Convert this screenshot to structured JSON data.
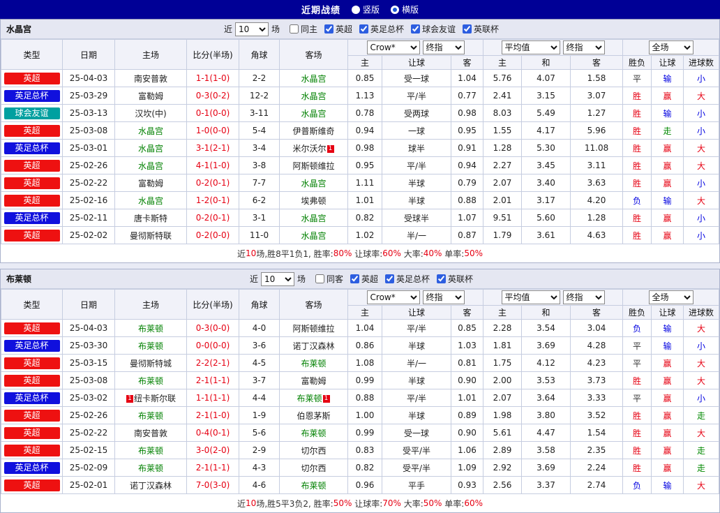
{
  "topbar": {
    "title": "近期战绩",
    "options": [
      {
        "label": "竖版",
        "selected": false
      },
      {
        "label": "横版",
        "selected": true
      }
    ]
  },
  "colors": {
    "red": "#ee1111",
    "blue": "#1010dd",
    "teal": "#00a0a0",
    "team_green": "#008000",
    "result_red": "#e60012",
    "result_blue": "#0000e0",
    "result_green": "#008800",
    "topbar_bg": "#000096"
  },
  "table_header": {
    "type": "类型",
    "date": "日期",
    "home": "主场",
    "score": "比分(半场)",
    "corner": "角球",
    "away": "客场",
    "bookmaker_select": "Crow*",
    "final_select_1": "终指",
    "avg_select": "平均值",
    "final_select_2": "终指",
    "scope_select": "全场",
    "sub_cols": [
      "主",
      "让球",
      "客",
      "主",
      "和",
      "客",
      "胜负",
      "让球",
      "进球数"
    ]
  },
  "sections": [
    {
      "team": "水晶宫",
      "filters": {
        "prefix": "近",
        "count": "10",
        "suffix": "场",
        "checkboxes": [
          {
            "label": "同主",
            "checked": false
          },
          {
            "label": "英超",
            "checked": true
          },
          {
            "label": "英足总杯",
            "checked": true
          },
          {
            "label": "球会友谊",
            "checked": true
          },
          {
            "label": "英联杯",
            "checked": true
          }
        ]
      },
      "rows": [
        {
          "league": "英超",
          "lc": "red",
          "date": "25-04-03",
          "home": "南安普敦",
          "hf": false,
          "hc": "",
          "score": "1-1(1-0)",
          "corner": "2-2",
          "away": "水晶宫",
          "af": true,
          "ac": "",
          "odds": [
            "0.85",
            "受一球",
            "1.04",
            "5.76",
            "4.07",
            "1.58"
          ],
          "res": [
            [
              "平",
              "k"
            ],
            [
              "输",
              "b"
            ],
            [
              "小",
              "b"
            ]
          ]
        },
        {
          "league": "英足总杯",
          "lc": "blue",
          "date": "25-03-29",
          "home": "富勒姆",
          "hf": false,
          "hc": "",
          "score": "0-3(0-2)",
          "corner": "12-2",
          "away": "水晶宫",
          "af": true,
          "ac": "",
          "odds": [
            "1.13",
            "平/半",
            "0.77",
            "2.41",
            "3.15",
            "3.07"
          ],
          "res": [
            [
              "胜",
              "r"
            ],
            [
              "赢",
              "r"
            ],
            [
              "大",
              "r"
            ]
          ]
        },
        {
          "league": "球会友谊",
          "lc": "teal",
          "date": "25-03-13",
          "home": "汉坎(中)",
          "hf": false,
          "hc": "",
          "score": "0-1(0-0)",
          "corner": "3-11",
          "away": "水晶宫",
          "af": true,
          "ac": "",
          "odds": [
            "0.78",
            "受两球",
            "0.98",
            "8.03",
            "5.49",
            "1.27"
          ],
          "res": [
            [
              "胜",
              "r"
            ],
            [
              "输",
              "b"
            ],
            [
              "小",
              "b"
            ]
          ]
        },
        {
          "league": "英超",
          "lc": "red",
          "date": "25-03-08",
          "home": "水晶宫",
          "hf": true,
          "hc": "",
          "score": "1-0(0-0)",
          "corner": "5-4",
          "away": "伊普斯维奇",
          "af": false,
          "ac": "",
          "odds": [
            "0.94",
            "一球",
            "0.95",
            "1.55",
            "4.17",
            "5.96"
          ],
          "res": [
            [
              "胜",
              "r"
            ],
            [
              "走",
              "g"
            ],
            [
              "小",
              "b"
            ]
          ]
        },
        {
          "league": "英足总杯",
          "lc": "blue",
          "date": "25-03-01",
          "home": "水晶宫",
          "hf": true,
          "hc": "",
          "score": "3-1(2-1)",
          "corner": "3-4",
          "away": "米尔沃尔",
          "af": false,
          "ac": "1",
          "odds": [
            "0.98",
            "球半",
            "0.91",
            "1.28",
            "5.30",
            "11.08"
          ],
          "res": [
            [
              "胜",
              "r"
            ],
            [
              "赢",
              "r"
            ],
            [
              "大",
              "r"
            ]
          ]
        },
        {
          "league": "英超",
          "lc": "red",
          "date": "25-02-26",
          "home": "水晶宫",
          "hf": true,
          "hc": "",
          "score": "4-1(1-0)",
          "corner": "3-8",
          "away": "阿斯顿维拉",
          "af": false,
          "ac": "",
          "odds": [
            "0.95",
            "平/半",
            "0.94",
            "2.27",
            "3.45",
            "3.11"
          ],
          "res": [
            [
              "胜",
              "r"
            ],
            [
              "赢",
              "r"
            ],
            [
              "大",
              "r"
            ]
          ]
        },
        {
          "league": "英超",
          "lc": "red",
          "date": "25-02-22",
          "home": "富勒姆",
          "hf": false,
          "hc": "",
          "score": "0-2(0-1)",
          "corner": "7-7",
          "away": "水晶宫",
          "af": true,
          "ac": "",
          "odds": [
            "1.11",
            "半球",
            "0.79",
            "2.07",
            "3.40",
            "3.63"
          ],
          "res": [
            [
              "胜",
              "r"
            ],
            [
              "赢",
              "r"
            ],
            [
              "小",
              "b"
            ]
          ]
        },
        {
          "league": "英超",
          "lc": "red",
          "date": "25-02-16",
          "home": "水晶宫",
          "hf": true,
          "hc": "",
          "score": "1-2(0-1)",
          "corner": "6-2",
          "away": "埃弗顿",
          "af": false,
          "ac": "",
          "odds": [
            "1.01",
            "半球",
            "0.88",
            "2.01",
            "3.17",
            "4.20"
          ],
          "res": [
            [
              "负",
              "b"
            ],
            [
              "输",
              "b"
            ],
            [
              "大",
              "r"
            ]
          ]
        },
        {
          "league": "英足总杯",
          "lc": "blue",
          "date": "25-02-11",
          "home": "唐卡斯特",
          "hf": false,
          "hc": "",
          "score": "0-2(0-1)",
          "corner": "3-1",
          "away": "水晶宫",
          "af": true,
          "ac": "",
          "odds": [
            "0.82",
            "受球半",
            "1.07",
            "9.51",
            "5.60",
            "1.28"
          ],
          "res": [
            [
              "胜",
              "r"
            ],
            [
              "赢",
              "r"
            ],
            [
              "小",
              "b"
            ]
          ]
        },
        {
          "league": "英超",
          "lc": "red",
          "date": "25-02-02",
          "home": "曼彻斯特联",
          "hf": false,
          "hc": "",
          "score": "0-2(0-0)",
          "corner": "11-0",
          "away": "水晶宫",
          "af": true,
          "ac": "",
          "odds": [
            "1.02",
            "半/一",
            "0.87",
            "1.79",
            "3.61",
            "4.63"
          ],
          "res": [
            [
              "胜",
              "r"
            ],
            [
              "赢",
              "r"
            ],
            [
              "小",
              "b"
            ]
          ]
        }
      ],
      "summary": [
        [
          "近",
          "k"
        ],
        [
          "10",
          "r"
        ],
        [
          "场,胜8平1负1, 胜率:",
          "k"
        ],
        [
          "80%",
          "r"
        ],
        [
          " 让球率:",
          "k"
        ],
        [
          "60%",
          "r"
        ],
        [
          " 大率:",
          "k"
        ],
        [
          "40%",
          "r"
        ],
        [
          " 单率:",
          "k"
        ],
        [
          "50%",
          "r"
        ]
      ]
    },
    {
      "team": "布莱顿",
      "filters": {
        "prefix": "近",
        "count": "10",
        "suffix": "场",
        "checkboxes": [
          {
            "label": "同客",
            "checked": false
          },
          {
            "label": "英超",
            "checked": true
          },
          {
            "label": "英足总杯",
            "checked": true
          },
          {
            "label": "英联杯",
            "checked": true
          }
        ]
      },
      "rows": [
        {
          "league": "英超",
          "lc": "red",
          "date": "25-04-03",
          "home": "布莱顿",
          "hf": true,
          "hc": "",
          "score": "0-3(0-0)",
          "corner": "4-0",
          "away": "阿斯顿维拉",
          "af": false,
          "ac": "",
          "odds": [
            "1.04",
            "平/半",
            "0.85",
            "2.28",
            "3.54",
            "3.04"
          ],
          "res": [
            [
              "负",
              "b"
            ],
            [
              "输",
              "b"
            ],
            [
              "大",
              "r"
            ]
          ]
        },
        {
          "league": "英足总杯",
          "lc": "blue",
          "date": "25-03-30",
          "home": "布莱顿",
          "hf": true,
          "hc": "",
          "score": "0-0(0-0)",
          "corner": "3-6",
          "away": "诺丁汉森林",
          "af": false,
          "ac": "",
          "odds": [
            "0.86",
            "半球",
            "1.03",
            "1.81",
            "3.69",
            "4.28"
          ],
          "res": [
            [
              "平",
              "k"
            ],
            [
              "输",
              "b"
            ],
            [
              "小",
              "b"
            ]
          ]
        },
        {
          "league": "英超",
          "lc": "red",
          "date": "25-03-15",
          "home": "曼彻斯特城",
          "hf": false,
          "hc": "",
          "score": "2-2(2-1)",
          "corner": "4-5",
          "away": "布莱顿",
          "af": true,
          "ac": "",
          "odds": [
            "1.08",
            "半/一",
            "0.81",
            "1.75",
            "4.12",
            "4.23"
          ],
          "res": [
            [
              "平",
              "k"
            ],
            [
              "赢",
              "r"
            ],
            [
              "大",
              "r"
            ]
          ]
        },
        {
          "league": "英超",
          "lc": "red",
          "date": "25-03-08",
          "home": "布莱顿",
          "hf": true,
          "hc": "",
          "score": "2-1(1-1)",
          "corner": "3-7",
          "away": "富勒姆",
          "af": false,
          "ac": "",
          "odds": [
            "0.99",
            "半球",
            "0.90",
            "2.00",
            "3.53",
            "3.73"
          ],
          "res": [
            [
              "胜",
              "r"
            ],
            [
              "赢",
              "r"
            ],
            [
              "大",
              "r"
            ]
          ]
        },
        {
          "league": "英足总杯",
          "lc": "blue",
          "date": "25-03-02",
          "home": "纽卡斯尔联",
          "hf": false,
          "hc": "1",
          "score": "1-1(1-1)",
          "corner": "4-4",
          "away": "布莱顿",
          "af": true,
          "ac": "1",
          "odds": [
            "0.88",
            "平/半",
            "1.01",
            "2.07",
            "3.64",
            "3.33"
          ],
          "res": [
            [
              "平",
              "k"
            ],
            [
              "赢",
              "r"
            ],
            [
              "小",
              "b"
            ]
          ]
        },
        {
          "league": "英超",
          "lc": "red",
          "date": "25-02-26",
          "home": "布莱顿",
          "hf": true,
          "hc": "",
          "score": "2-1(1-0)",
          "corner": "1-9",
          "away": "伯恩茅斯",
          "af": false,
          "ac": "",
          "odds": [
            "1.00",
            "半球",
            "0.89",
            "1.98",
            "3.80",
            "3.52"
          ],
          "res": [
            [
              "胜",
              "r"
            ],
            [
              "赢",
              "r"
            ],
            [
              "走",
              "g"
            ]
          ]
        },
        {
          "league": "英超",
          "lc": "red",
          "date": "25-02-22",
          "home": "南安普敦",
          "hf": false,
          "hc": "",
          "score": "0-4(0-1)",
          "corner": "5-6",
          "away": "布莱顿",
          "af": true,
          "ac": "",
          "odds": [
            "0.99",
            "受一球",
            "0.90",
            "5.61",
            "4.47",
            "1.54"
          ],
          "res": [
            [
              "胜",
              "r"
            ],
            [
              "赢",
              "r"
            ],
            [
              "大",
              "r"
            ]
          ]
        },
        {
          "league": "英超",
          "lc": "red",
          "date": "25-02-15",
          "home": "布莱顿",
          "hf": true,
          "hc": "",
          "score": "3-0(2-0)",
          "corner": "2-9",
          "away": "切尔西",
          "af": false,
          "ac": "",
          "odds": [
            "0.83",
            "受平/半",
            "1.06",
            "2.89",
            "3.58",
            "2.35"
          ],
          "res": [
            [
              "胜",
              "r"
            ],
            [
              "赢",
              "r"
            ],
            [
              "走",
              "g"
            ]
          ]
        },
        {
          "league": "英足总杯",
          "lc": "blue",
          "date": "25-02-09",
          "home": "布莱顿",
          "hf": true,
          "hc": "",
          "score": "2-1(1-1)",
          "corner": "4-3",
          "away": "切尔西",
          "af": false,
          "ac": "",
          "odds": [
            "0.82",
            "受平/半",
            "1.09",
            "2.92",
            "3.69",
            "2.24"
          ],
          "res": [
            [
              "胜",
              "r"
            ],
            [
              "赢",
              "r"
            ],
            [
              "走",
              "g"
            ]
          ]
        },
        {
          "league": "英超",
          "lc": "red",
          "date": "25-02-01",
          "home": "诺丁汉森林",
          "hf": false,
          "hc": "",
          "score": "7-0(3-0)",
          "corner": "4-6",
          "away": "布莱顿",
          "af": true,
          "ac": "",
          "odds": [
            "0.96",
            "平手",
            "0.93",
            "2.56",
            "3.37",
            "2.74"
          ],
          "res": [
            [
              "负",
              "b"
            ],
            [
              "输",
              "b"
            ],
            [
              "大",
              "r"
            ]
          ]
        }
      ],
      "summary": [
        [
          "近",
          "k"
        ],
        [
          "10",
          "r"
        ],
        [
          "场,胜5平3负2, 胜率:",
          "k"
        ],
        [
          "50%",
          "r"
        ],
        [
          " 让球率:",
          "k"
        ],
        [
          "70%",
          "r"
        ],
        [
          " 大率:",
          "k"
        ],
        [
          "50%",
          "r"
        ],
        [
          " 单率:",
          "k"
        ],
        [
          "60%",
          "r"
        ]
      ]
    }
  ]
}
